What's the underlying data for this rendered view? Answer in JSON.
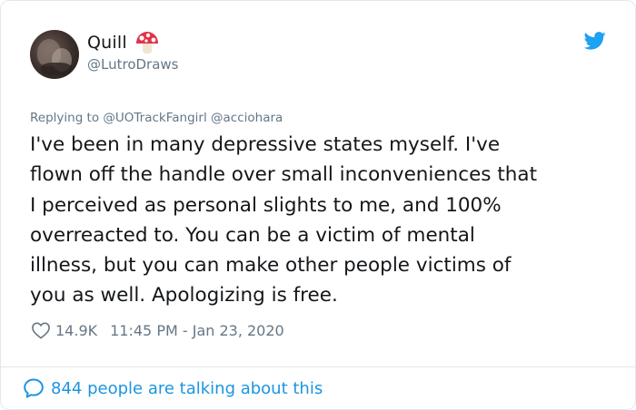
{
  "tweet": {
    "author": {
      "display_name": "Quill",
      "handle": "@LutroDraws",
      "name_emoji": "mushroom"
    },
    "reply_prefix": "Replying to",
    "reply_to": [
      "@UOTrackFangirl",
      "@acciohara"
    ],
    "text": "I've been in many depressive states myself. I've\nflown off the handle over small inconveniences that\nI perceived as personal slights to me, and 100%\noverreacted to. You can be a victim of mental\nillness, but you can make other people victims of\nyou as well. Apologizing is free.",
    "likes": "14.9K",
    "timestamp": "11:45 PM - Jan 23, 2020",
    "talking_count_text": "844 people are talking about this"
  },
  "icons": [
    "twitter-bird-icon",
    "heart-icon",
    "speech-bubble-icon",
    "mushroom-emoji"
  ],
  "colors": {
    "text_primary": "#14171a",
    "text_secondary": "#657786",
    "accent_blue": "#1da1f2",
    "link_blue": "#1b95e0",
    "border": "#e1e8ed",
    "mushroom_red": "#e0334a"
  }
}
